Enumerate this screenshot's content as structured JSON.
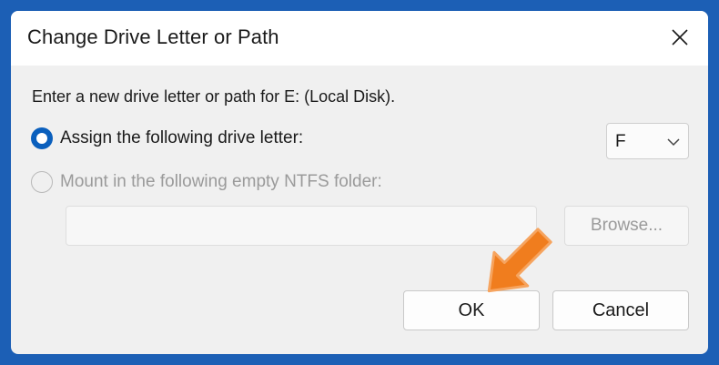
{
  "dialog": {
    "title": "Change Drive Letter or Path",
    "close_icon": "close-icon",
    "prompt": "Enter a new drive letter or path for E: (Local Disk).",
    "options": {
      "assign_label": "Assign the following drive letter:",
      "assign_selected": true,
      "mount_label": "Mount in the following empty NTFS folder:",
      "mount_enabled": false
    },
    "drive_letter": {
      "value": "F",
      "icon": "chevron-down-icon"
    },
    "folder_path": {
      "value": ""
    },
    "browse_label": "Browse...",
    "ok_label": "OK",
    "cancel_label": "Cancel"
  },
  "annotation": {
    "arrow_color": "#f07d1e",
    "points_to": "OK"
  },
  "colors": {
    "accent": "#0a5fbd",
    "background": "#1c5fb5"
  }
}
